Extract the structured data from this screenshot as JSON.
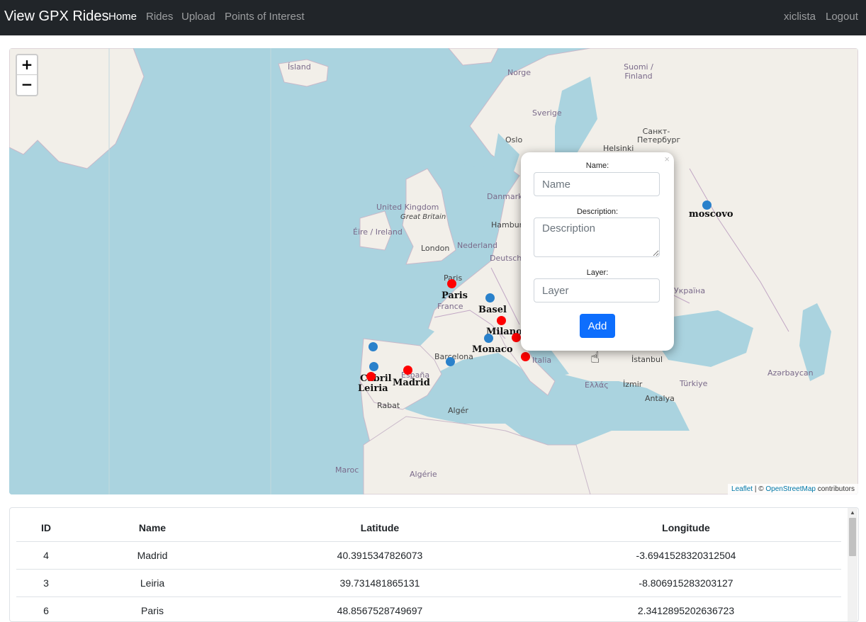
{
  "navbar": {
    "brand": "View GPX Rides",
    "links": [
      {
        "label": "Home",
        "active": true
      },
      {
        "label": "Rides"
      },
      {
        "label": "Upload"
      },
      {
        "label": "Points of Interest"
      }
    ],
    "user": "xiclista",
    "logout": "Logout"
  },
  "map": {
    "zoom_in": "+",
    "zoom_out": "−",
    "country_labels": [
      "Ísland",
      "Norge",
      "Suomi / Finland",
      "Sverige",
      "Helsinki",
      "Санкт-Петербург",
      "Oslo",
      "Danmark",
      "United Kingdom",
      "Great Britain",
      "Éire / Ireland",
      "London",
      "Nederland",
      "Hamburg",
      "Deutschl",
      "Paris",
      "France",
      "Barcelona",
      "España",
      "Italia",
      "Rabat",
      "Algér",
      "Maroc",
      "Algérie",
      "Türkiye",
      "İstanbul",
      "Ελλάς",
      "İzmir",
      "Antalya",
      "Azərbaycan",
      "Україна"
    ],
    "city_labels": [
      "Paris",
      "Basel",
      "Milano",
      "Monaco",
      "Cabril",
      "Leiria",
      "Madrid",
      "moscovo"
    ],
    "attribution_leaflet": "Leaflet",
    "attribution_sep": " | © ",
    "attribution_osm": "OpenStreetMap",
    "attribution_tail": " contributors",
    "marker_colors": {
      "ride": "#ff0000",
      "poi": "#2a81cb"
    }
  },
  "popup": {
    "close": "×",
    "name_label": "Name:",
    "name_placeholder": "Name",
    "description_label": "Description:",
    "description_placeholder": "Description",
    "layer_label": "Layer:",
    "layer_placeholder": "Layer",
    "add_button": "Add"
  },
  "table": {
    "headers": [
      "ID",
      "Name",
      "Latitude",
      "Longitude"
    ],
    "rows": [
      {
        "id": "4",
        "name": "Madrid",
        "lat": "40.3915347826073",
        "lon": "-3.6941528320312504"
      },
      {
        "id": "3",
        "name": "Leiria",
        "lat": "39.731481865131",
        "lon": "-8.806915283203127"
      },
      {
        "id": "6",
        "name": "Paris",
        "lat": "48.8567528749697",
        "lon": "2.3412895202636723"
      }
    ]
  }
}
